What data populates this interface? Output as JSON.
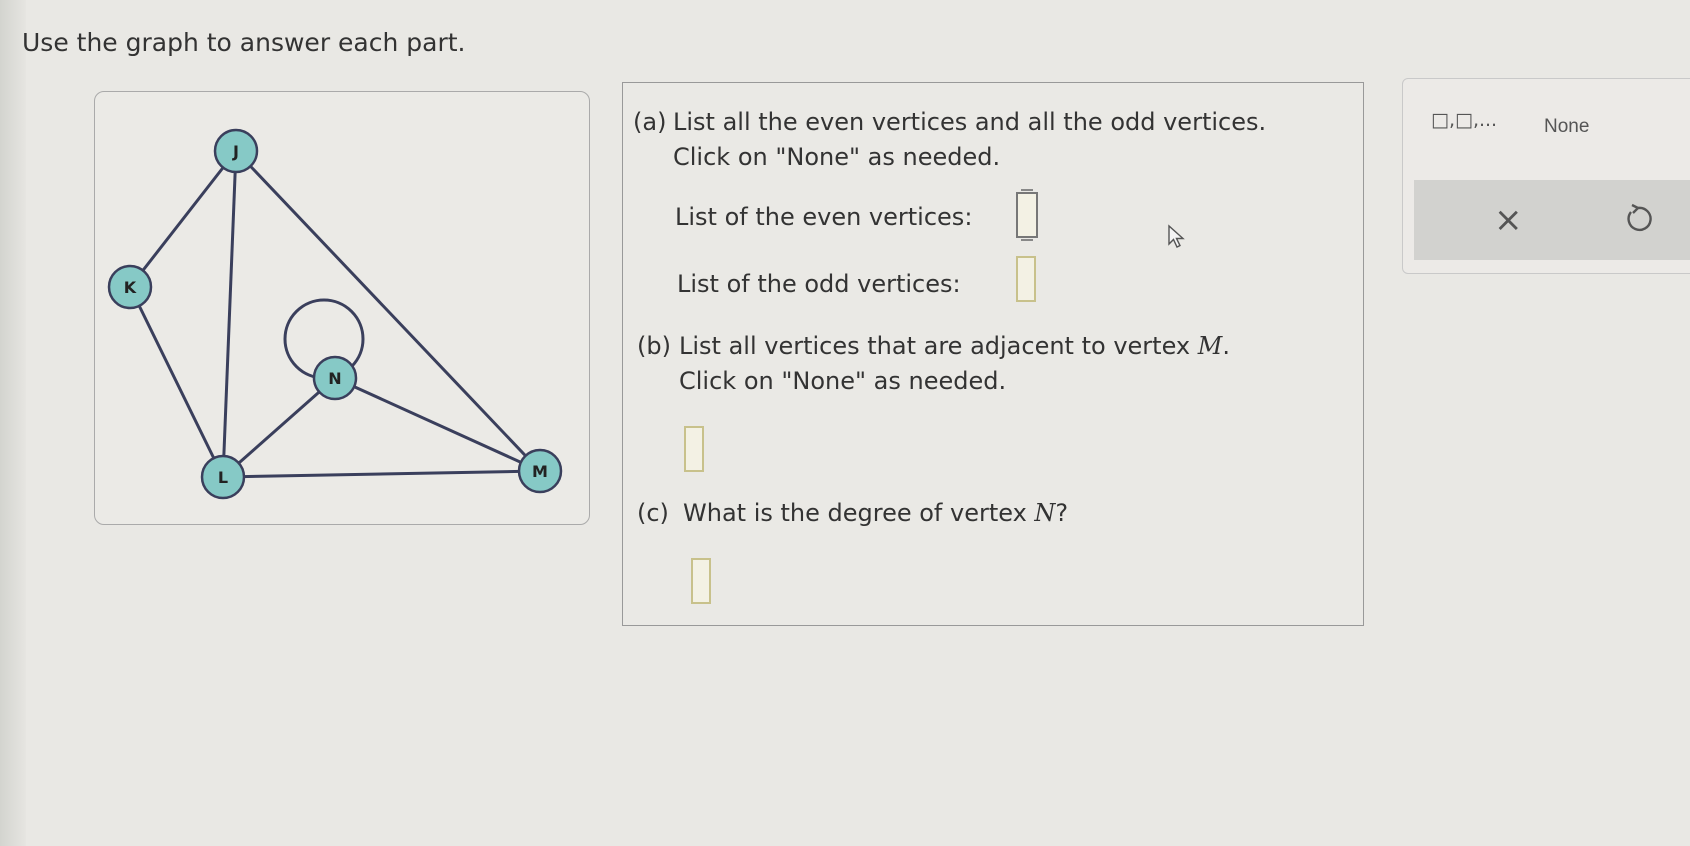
{
  "instructions": "Use the graph to answer each part.",
  "graph": {
    "vertices": [
      "J",
      "K",
      "N",
      "L",
      "M"
    ]
  },
  "questions": {
    "a": {
      "label": "(a)",
      "line1": "List all the even vertices and all the odd vertices.",
      "line2": "Click on \"None\" as needed.",
      "even_label": "List of the even vertices:",
      "odd_label": "List of the odd vertices:"
    },
    "b": {
      "label": "(b)",
      "line1_pre": "List all vertices that are adjacent to vertex ",
      "line1_var": "M",
      "line1_post": ".",
      "line2": "Click on \"None\" as needed."
    },
    "c": {
      "label": "(c)",
      "pre": "What is the degree of vertex ",
      "var": "N",
      "post": "?"
    }
  },
  "toolbar": {
    "list_template": "□,□,...",
    "none_label": "None",
    "clear_icon": "×",
    "undo_icon": "undo-icon"
  },
  "colors": {
    "vertex_fill": "#86c9c6",
    "edge": "#3a3f5c",
    "answer_box_border": "#c8c18b"
  }
}
